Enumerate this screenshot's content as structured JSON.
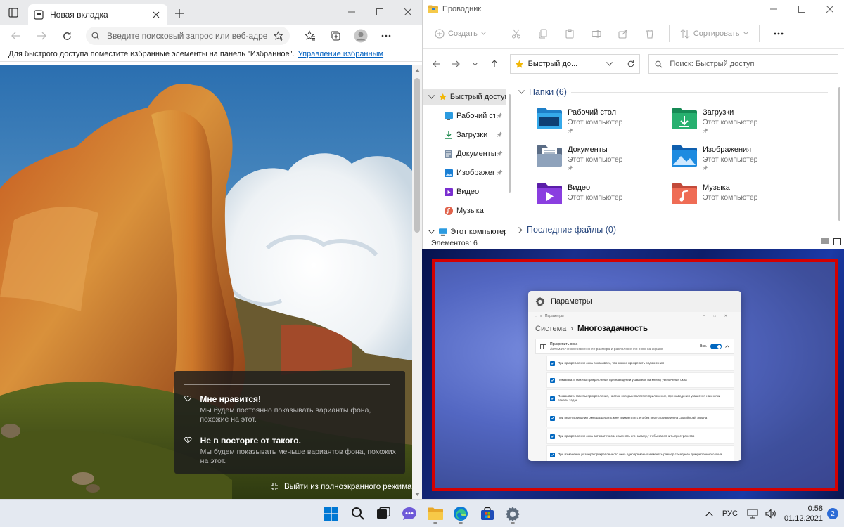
{
  "edge": {
    "tab_title": "Новая вкладка",
    "address_placeholder": "Введите поисковый запрос или веб-адрес",
    "favbar_text": "Для быстрого доступа поместите избранные элементы на панель \"Избранное\".",
    "favbar_link": "Управление избранным",
    "feedback": {
      "like_title": "Мне нравится!",
      "like_desc": "Мы будем постоянно показывать варианты фона, похожие на этот.",
      "dislike_title": "Не в восторге от такого.",
      "dislike_desc": "Мы будем показывать меньше вариантов фона, похожих на этот."
    },
    "exit_fullscreen": "Выйти из полноэкранного режима"
  },
  "explorer": {
    "title": "Проводник",
    "ribbon": {
      "create": "Создать",
      "sort": "Сортировать"
    },
    "address": "Быстрый до...",
    "search_placeholder": "Поиск: Быстрый доступ",
    "nav": [
      {
        "label": "Быстрый доступ"
      },
      {
        "label": "Рабочий стол"
      },
      {
        "label": "Загрузки"
      },
      {
        "label": "Документы"
      },
      {
        "label": "Изображения"
      },
      {
        "label": "Видео"
      },
      {
        "label": "Музыка"
      },
      {
        "label": "Этот компьютер"
      }
    ],
    "folders_header": "Папки (6)",
    "recent_header": "Последние файлы (0)",
    "folders": [
      {
        "name": "Рабочий стол",
        "sub": "Этот компьютер"
      },
      {
        "name": "Загрузки",
        "sub": "Этот компьютер"
      },
      {
        "name": "Документы",
        "sub": "Этот компьютер"
      },
      {
        "name": "Изображения",
        "sub": "Этот компьютер"
      },
      {
        "name": "Видео",
        "sub": "Этот компьютер"
      },
      {
        "name": "Музыка",
        "sub": "Этот компьютер"
      }
    ],
    "status": "Элементов: 6"
  },
  "params": {
    "title": "Параметры",
    "mini_title": "Параметры",
    "crumb_parent": "Система",
    "crumb_current": "Многозадачность",
    "snap_title": "Прикрепить окна",
    "snap_desc": "Автоматическое изменение размера и расположения окон на экране",
    "snap_state": "Вкл.",
    "options": [
      "При прикреплении окна показывать, что можно прикрепить рядом с ним",
      "Показывать макеты прикрепления при наведении указателя на кнопку увеличения окна",
      "Показывать макеты прикрепления, частью которых является приложение, при наведении указателя на кнопки панели задач",
      "При перетаскивании окна разрешить мне прикреплять его без перетаскивания на самый край экрана",
      "При прикреплении окна автоматически изменять его размер, чтобы заполнить пространство",
      "При изменении размера прикрепленного окна одновременно изменять размер соседнего прикрепленного окна"
    ]
  },
  "taskbar": {
    "language": "РУС",
    "time": "0:58",
    "date": "01.12.2021",
    "notifications": "2"
  }
}
